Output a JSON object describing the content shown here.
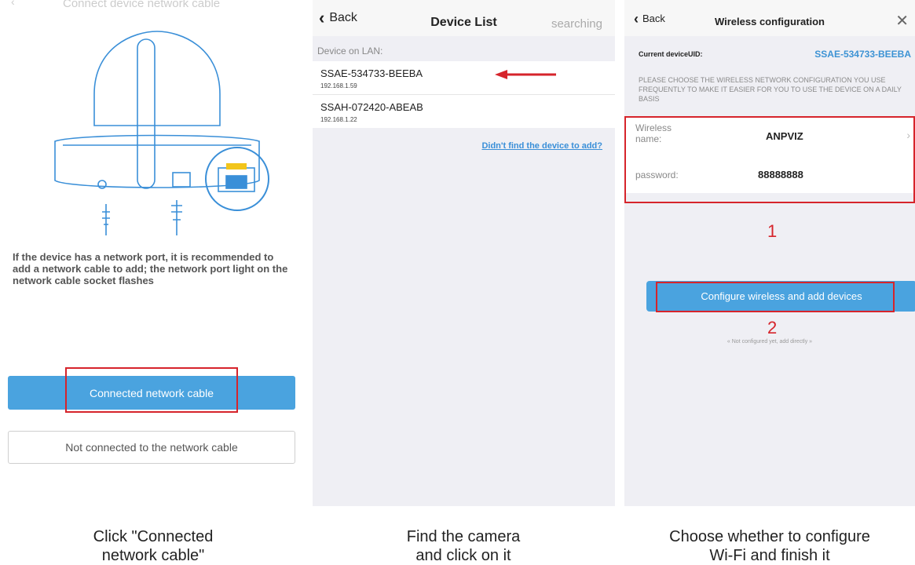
{
  "panel1": {
    "faint_header": "Connect device network cable",
    "description": "If the device has a network port, it is recommended to add a network cable to add; the network port light on the network cable socket flashes",
    "btn_connected": "Connected network cable",
    "btn_not_connected": "Not connected to the network cable",
    "caption": "Click \"Connected\nnetwork cable\""
  },
  "panel2": {
    "back_label": "Back",
    "title": "Device List",
    "status": "searching",
    "section_label": "Device on LAN:",
    "devices": [
      {
        "name": "SSAE-534733-BEEBA",
        "ip": "192.168.1.59"
      },
      {
        "name": "SSAH-072420-ABEAB",
        "ip": "192.168.1.22"
      }
    ],
    "find_link": "Didn't find the device to add?",
    "caption": "Find the camera\nand click on it"
  },
  "panel3": {
    "back_label": "Back",
    "title": "Wireless configuration",
    "uid_label": "Current deviceUID:",
    "uid_value": "SSAE-534733-BEEBA",
    "hint": "PLEASE CHOOSE THE WIRELESS NETWORK CONFIGURATION YOU USE FREQUENTLY TO MAKE IT EASIER FOR YOU TO USE THE DEVICE ON A DAILY BASIS",
    "wireless_label": "Wireless name:",
    "wireless_value": "ANPVIZ",
    "password_label": "password:",
    "password_value": "88888888",
    "annotation_1": "1",
    "annotation_2": "2",
    "btn_config": "Configure wireless and add devices",
    "not_configured": "« Not configured yet, add directly »",
    "caption": "Choose whether to configure\nWi-Fi and finish it"
  },
  "colors": {
    "accent_blue": "#4aa3df",
    "annotation_red": "#d6242b",
    "link_blue": "#3a8fd8",
    "uid_blue": "#3d93d4"
  },
  "icons": {
    "back": "chevron-left-icon",
    "close": "close-icon",
    "row_chevron": "chevron-right-icon",
    "arrow": "red-arrow-left-icon"
  }
}
